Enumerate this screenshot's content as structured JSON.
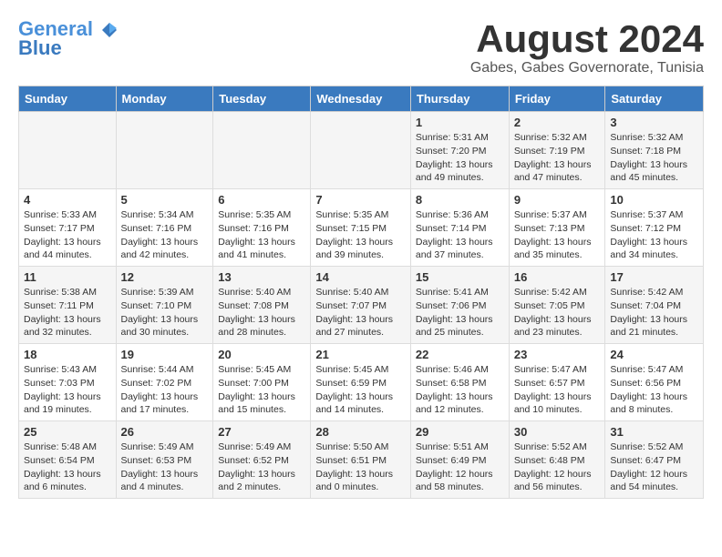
{
  "header": {
    "logo_line1": "General",
    "logo_line2": "Blue",
    "month_title": "August 2024",
    "subtitle": "Gabes, Gabes Governorate, Tunisia"
  },
  "weekdays": [
    "Sunday",
    "Monday",
    "Tuesday",
    "Wednesday",
    "Thursday",
    "Friday",
    "Saturday"
  ],
  "weeks": [
    [
      {
        "day": "",
        "info": ""
      },
      {
        "day": "",
        "info": ""
      },
      {
        "day": "",
        "info": ""
      },
      {
        "day": "",
        "info": ""
      },
      {
        "day": "1",
        "info": "Sunrise: 5:31 AM\nSunset: 7:20 PM\nDaylight: 13 hours\nand 49 minutes."
      },
      {
        "day": "2",
        "info": "Sunrise: 5:32 AM\nSunset: 7:19 PM\nDaylight: 13 hours\nand 47 minutes."
      },
      {
        "day": "3",
        "info": "Sunrise: 5:32 AM\nSunset: 7:18 PM\nDaylight: 13 hours\nand 45 minutes."
      }
    ],
    [
      {
        "day": "4",
        "info": "Sunrise: 5:33 AM\nSunset: 7:17 PM\nDaylight: 13 hours\nand 44 minutes."
      },
      {
        "day": "5",
        "info": "Sunrise: 5:34 AM\nSunset: 7:16 PM\nDaylight: 13 hours\nand 42 minutes."
      },
      {
        "day": "6",
        "info": "Sunrise: 5:35 AM\nSunset: 7:16 PM\nDaylight: 13 hours\nand 41 minutes."
      },
      {
        "day": "7",
        "info": "Sunrise: 5:35 AM\nSunset: 7:15 PM\nDaylight: 13 hours\nand 39 minutes."
      },
      {
        "day": "8",
        "info": "Sunrise: 5:36 AM\nSunset: 7:14 PM\nDaylight: 13 hours\nand 37 minutes."
      },
      {
        "day": "9",
        "info": "Sunrise: 5:37 AM\nSunset: 7:13 PM\nDaylight: 13 hours\nand 35 minutes."
      },
      {
        "day": "10",
        "info": "Sunrise: 5:37 AM\nSunset: 7:12 PM\nDaylight: 13 hours\nand 34 minutes."
      }
    ],
    [
      {
        "day": "11",
        "info": "Sunrise: 5:38 AM\nSunset: 7:11 PM\nDaylight: 13 hours\nand 32 minutes."
      },
      {
        "day": "12",
        "info": "Sunrise: 5:39 AM\nSunset: 7:10 PM\nDaylight: 13 hours\nand 30 minutes."
      },
      {
        "day": "13",
        "info": "Sunrise: 5:40 AM\nSunset: 7:08 PM\nDaylight: 13 hours\nand 28 minutes."
      },
      {
        "day": "14",
        "info": "Sunrise: 5:40 AM\nSunset: 7:07 PM\nDaylight: 13 hours\nand 27 minutes."
      },
      {
        "day": "15",
        "info": "Sunrise: 5:41 AM\nSunset: 7:06 PM\nDaylight: 13 hours\nand 25 minutes."
      },
      {
        "day": "16",
        "info": "Sunrise: 5:42 AM\nSunset: 7:05 PM\nDaylight: 13 hours\nand 23 minutes."
      },
      {
        "day": "17",
        "info": "Sunrise: 5:42 AM\nSunset: 7:04 PM\nDaylight: 13 hours\nand 21 minutes."
      }
    ],
    [
      {
        "day": "18",
        "info": "Sunrise: 5:43 AM\nSunset: 7:03 PM\nDaylight: 13 hours\nand 19 minutes."
      },
      {
        "day": "19",
        "info": "Sunrise: 5:44 AM\nSunset: 7:02 PM\nDaylight: 13 hours\nand 17 minutes."
      },
      {
        "day": "20",
        "info": "Sunrise: 5:45 AM\nSunset: 7:00 PM\nDaylight: 13 hours\nand 15 minutes."
      },
      {
        "day": "21",
        "info": "Sunrise: 5:45 AM\nSunset: 6:59 PM\nDaylight: 13 hours\nand 14 minutes."
      },
      {
        "day": "22",
        "info": "Sunrise: 5:46 AM\nSunset: 6:58 PM\nDaylight: 13 hours\nand 12 minutes."
      },
      {
        "day": "23",
        "info": "Sunrise: 5:47 AM\nSunset: 6:57 PM\nDaylight: 13 hours\nand 10 minutes."
      },
      {
        "day": "24",
        "info": "Sunrise: 5:47 AM\nSunset: 6:56 PM\nDaylight: 13 hours\nand 8 minutes."
      }
    ],
    [
      {
        "day": "25",
        "info": "Sunrise: 5:48 AM\nSunset: 6:54 PM\nDaylight: 13 hours\nand 6 minutes."
      },
      {
        "day": "26",
        "info": "Sunrise: 5:49 AM\nSunset: 6:53 PM\nDaylight: 13 hours\nand 4 minutes."
      },
      {
        "day": "27",
        "info": "Sunrise: 5:49 AM\nSunset: 6:52 PM\nDaylight: 13 hours\nand 2 minutes."
      },
      {
        "day": "28",
        "info": "Sunrise: 5:50 AM\nSunset: 6:51 PM\nDaylight: 13 hours\nand 0 minutes."
      },
      {
        "day": "29",
        "info": "Sunrise: 5:51 AM\nSunset: 6:49 PM\nDaylight: 12 hours\nand 58 minutes."
      },
      {
        "day": "30",
        "info": "Sunrise: 5:52 AM\nSunset: 6:48 PM\nDaylight: 12 hours\nand 56 minutes."
      },
      {
        "day": "31",
        "info": "Sunrise: 5:52 AM\nSunset: 6:47 PM\nDaylight: 12 hours\nand 54 minutes."
      }
    ]
  ]
}
